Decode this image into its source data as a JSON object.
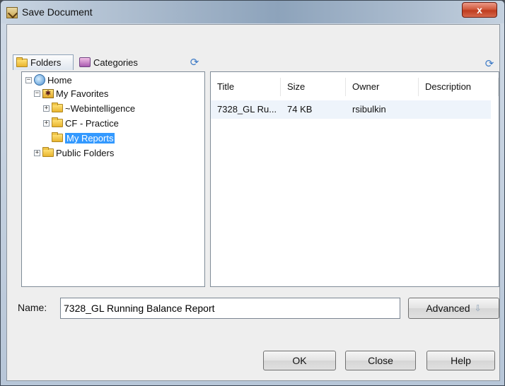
{
  "window": {
    "title": "Save Document",
    "close_glyph": "x"
  },
  "tabs": [
    {
      "label": "Folders",
      "icon": "folder-icon"
    },
    {
      "label": "Categories",
      "icon": "categories-icon"
    }
  ],
  "tree": {
    "items": [
      {
        "label": "Home",
        "toggle": "−",
        "icon": "home-icon"
      },
      {
        "label": "My Favorites",
        "toggle": "−",
        "icon": "favorites-icon",
        "glyph": "✱"
      },
      {
        "label": "~Webintelligence",
        "toggle": "+",
        "icon": "folder-icon"
      },
      {
        "label": "CF - Practice",
        "toggle": "+",
        "icon": "folder-icon"
      },
      {
        "label": "My Reports",
        "toggle": "",
        "icon": "folder-icon",
        "selected": true
      },
      {
        "label": "Public Folders",
        "toggle": "+",
        "icon": "folder-icon"
      }
    ]
  },
  "list": {
    "columns": [
      "Title",
      "Size",
      "Owner",
      "Description"
    ],
    "rows": [
      {
        "title": "7328_GL Ru...",
        "size": "74 KB",
        "owner": "rsibulkin",
        "description": ""
      }
    ]
  },
  "name_field": {
    "label": "Name:",
    "value": "7328_GL Running Balance Report"
  },
  "buttons": {
    "advanced": "Advanced",
    "ok": "OK",
    "close": "Close",
    "help": "Help"
  },
  "colors": {
    "selection": "#3399ff",
    "close_button": "#c9472a",
    "row_highlight": "#eef4fb"
  }
}
